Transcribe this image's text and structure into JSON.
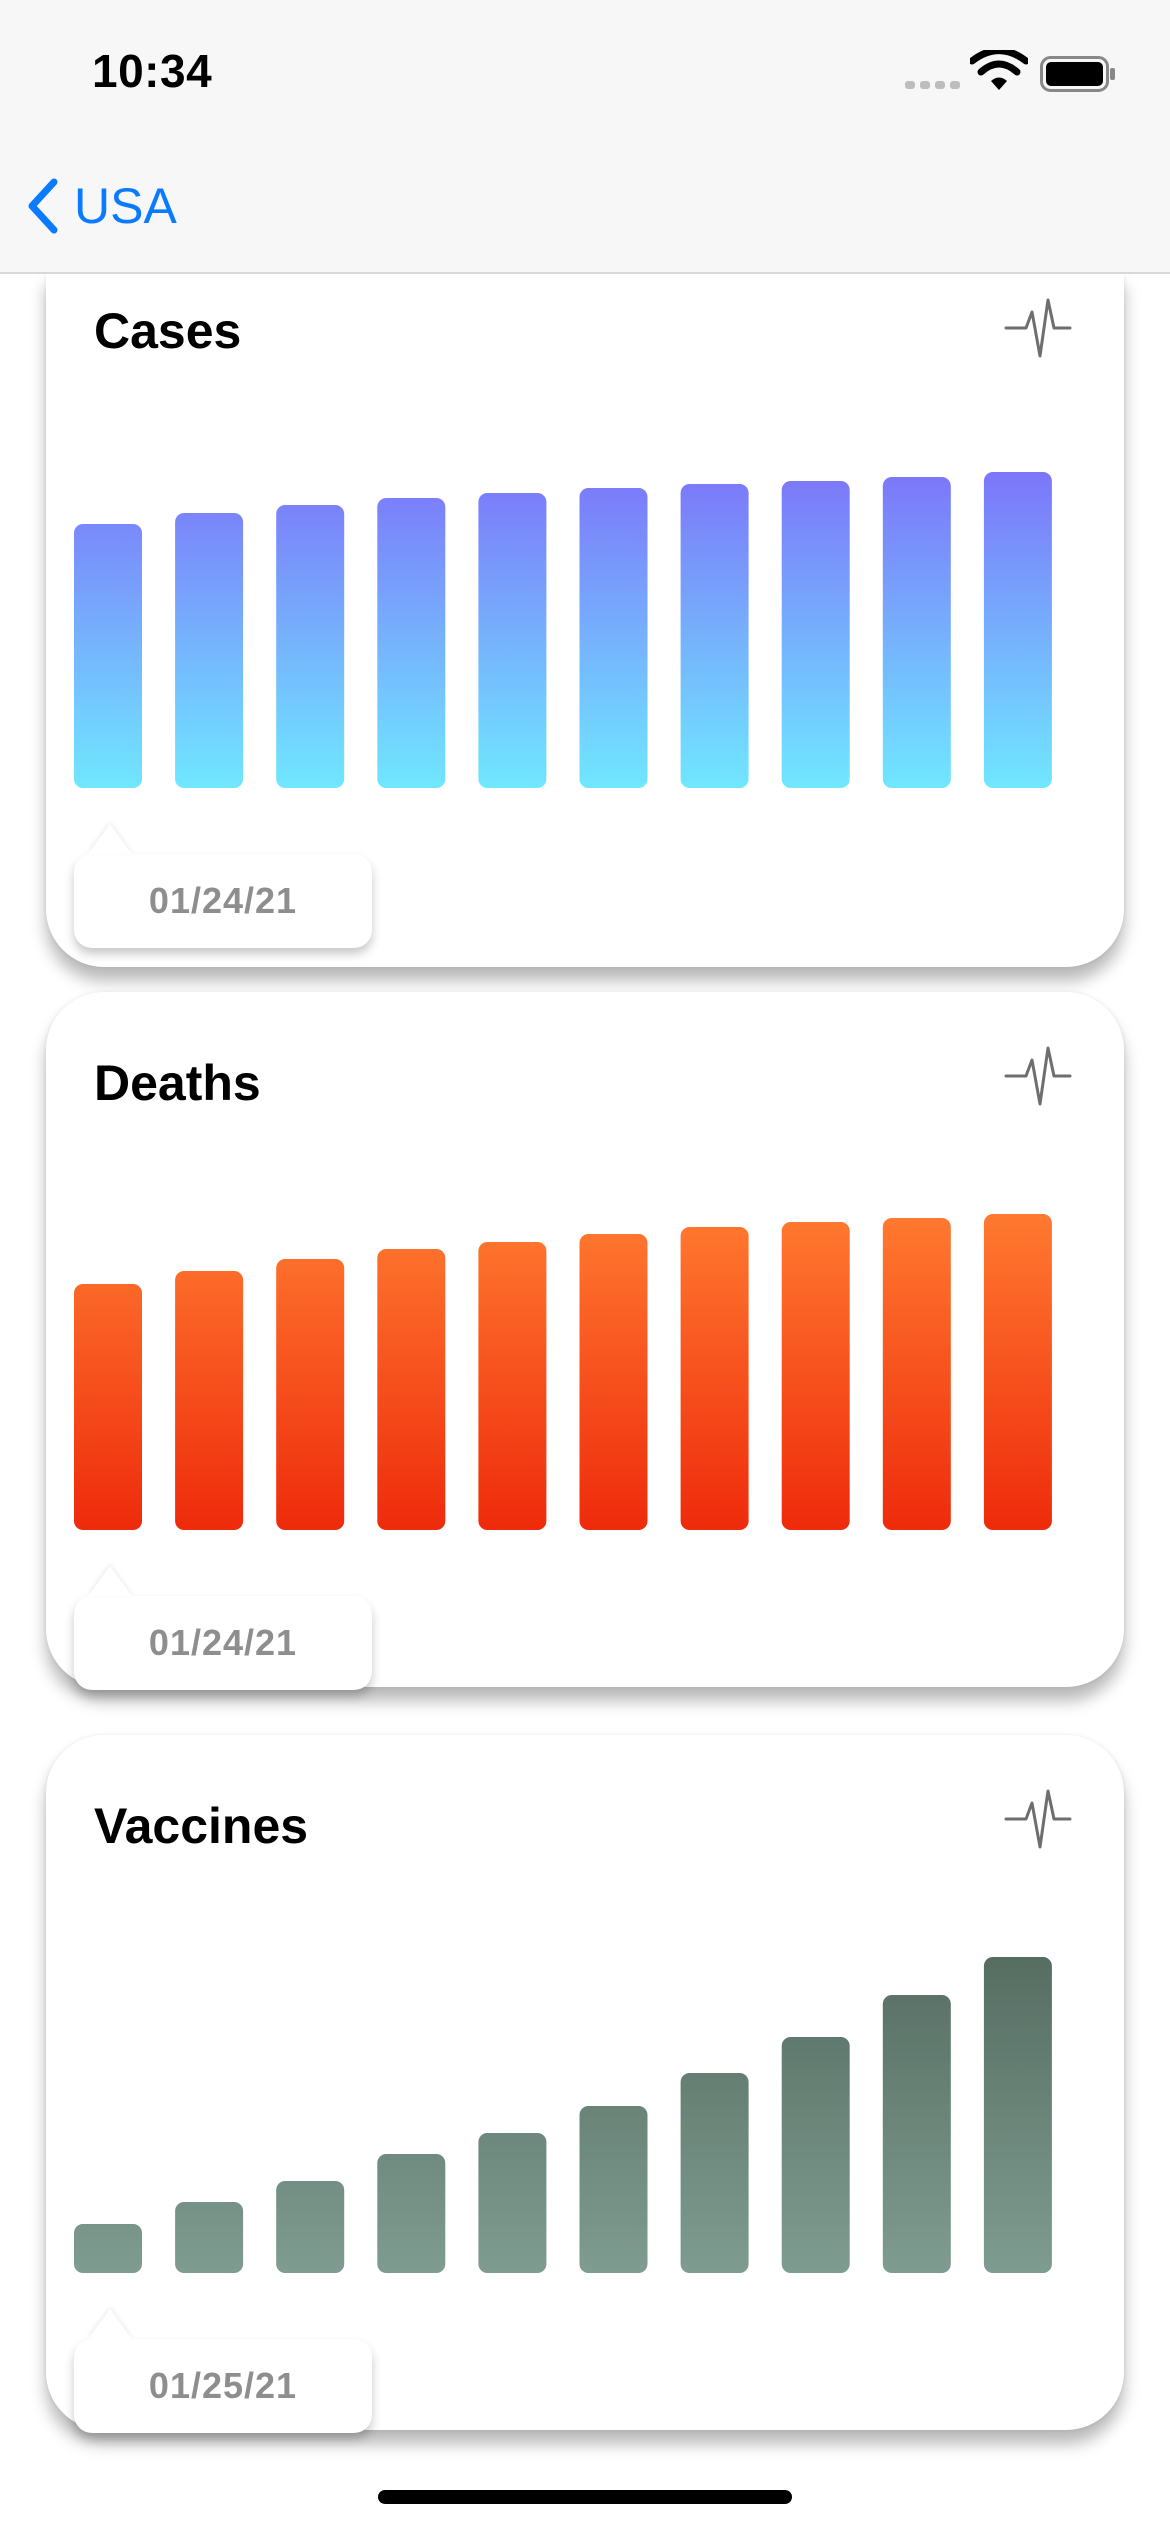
{
  "status_bar": {
    "time": "10:34"
  },
  "nav": {
    "back_label": "USA"
  },
  "cards": [
    {
      "title": "Cases",
      "icon": "pulse-icon",
      "tooltip_date": "01/24/21",
      "colors": {
        "top": "#7c76f9",
        "bottom": "#70e7ff"
      }
    },
    {
      "title": "Deaths",
      "icon": "pulse-icon",
      "tooltip_date": "01/24/21",
      "colors": {
        "top": "#ff7a30",
        "bottom": "#ee2b0c"
      }
    },
    {
      "title": "Vaccines",
      "icon": "pulse-icon",
      "tooltip_date": "01/25/21",
      "colors": {
        "top": "#566d62",
        "bottom": "#7f9c90"
      }
    }
  ],
  "chart_data": [
    {
      "type": "bar",
      "title": "Cases",
      "values": [
        264,
        275,
        283,
        290,
        295,
        300,
        304,
        307,
        311,
        316
      ],
      "ylim": [
        0,
        316
      ]
    },
    {
      "type": "bar",
      "title": "Deaths",
      "values": [
        246,
        259,
        271,
        281,
        288,
        296,
        303,
        308,
        312,
        316
      ],
      "ylim": [
        0,
        316
      ]
    },
    {
      "type": "bar",
      "title": "Vaccines",
      "values": [
        49,
        71,
        92,
        119,
        140,
        167,
        200,
        236,
        278,
        316
      ],
      "ylim": [
        0,
        316
      ]
    }
  ]
}
